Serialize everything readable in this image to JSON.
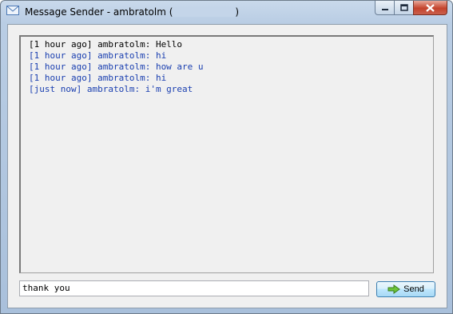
{
  "window": {
    "title_prefix": "Message Sender - ambratolm (",
    "title_suffix": ")"
  },
  "colors": {
    "sent": "#000000",
    "received": "#1a3fb0"
  },
  "messages": [
    {
      "text": "[1 hour ago] ambratolm: Hello",
      "color": "#000000"
    },
    {
      "text": "[1 hour ago] ambratolm: hi",
      "color": "#1a3fb0"
    },
    {
      "text": "[1 hour ago] ambratolm: how are u",
      "color": "#1a3fb0"
    },
    {
      "text": "[1 hour ago] ambratolm: hi",
      "color": "#1a3fb0"
    },
    {
      "text": "[just now] ambratolm: i'm great",
      "color": "#1a3fb0"
    }
  ],
  "composer": {
    "value": "thank you",
    "send_label": "Send",
    "send_icon": "arrow-right-icon"
  }
}
